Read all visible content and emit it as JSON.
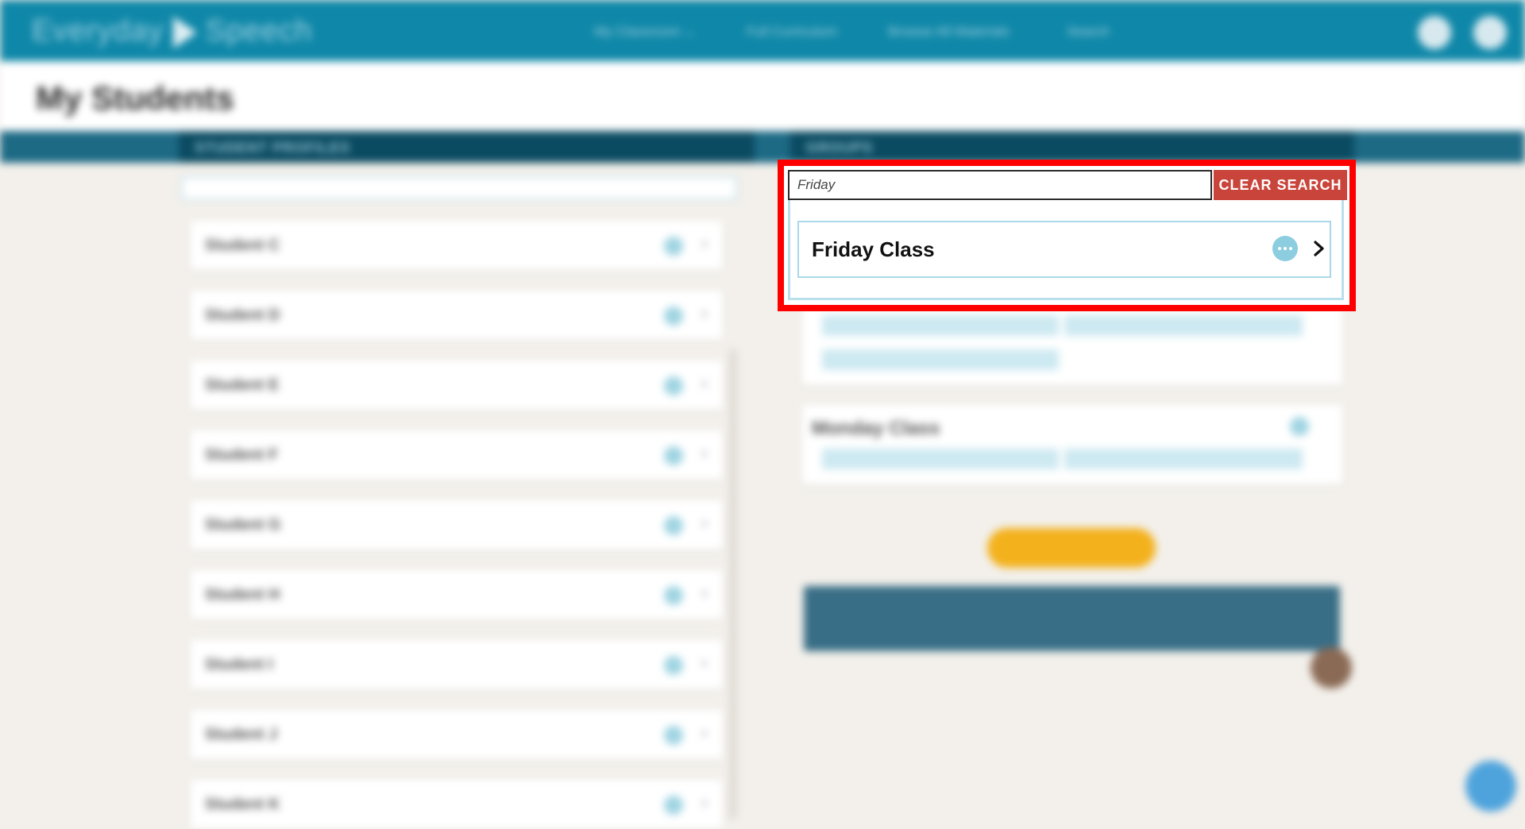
{
  "header": {
    "logo_text_left": "Everyday",
    "logo_text_right": "Speech",
    "nav": [
      {
        "label": "My Classroom ⌄"
      },
      {
        "label": "Full Curriculum"
      },
      {
        "label": "Browse All Materials"
      },
      {
        "label": "Search"
      }
    ]
  },
  "page": {
    "title": "My Students"
  },
  "sections": {
    "students_label": "STUDENT PROFILES",
    "groups_label": "GROUPS"
  },
  "students": [
    {
      "name": "Student C"
    },
    {
      "name": "Student D"
    },
    {
      "name": "Student E"
    },
    {
      "name": "Student F"
    },
    {
      "name": "Student G"
    },
    {
      "name": "Student H"
    },
    {
      "name": "Student I"
    },
    {
      "name": "Student J"
    },
    {
      "name": "Student K"
    }
  ],
  "groups": [
    {
      "title": "Monday Class"
    }
  ],
  "search": {
    "value": "Friday",
    "clear_label": "CLEAR SEARCH"
  },
  "results": [
    {
      "label": "Friday Class"
    }
  ],
  "colors": {
    "header": "#0f87a8",
    "clear_button": "#c9453b",
    "highlight_frame": "#ff0000",
    "accent_light": "#8ccde0"
  }
}
